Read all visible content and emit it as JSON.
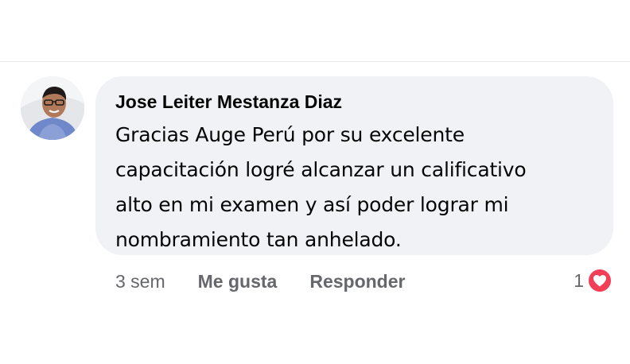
{
  "comment": {
    "author": "Jose Leiter Mestanza Diaz",
    "text_lines": [
      "Gracias Auge Perú por su excelente",
      "capacitación logré alcanzar un calificativo",
      "alto en mi examen y así poder lograr mi",
      "nombramiento tan anhelado."
    ],
    "timestamp": "3 sem",
    "like_label": "Me gusta",
    "reply_label": "Responder",
    "reaction_count": "1",
    "reaction_icon": "love-heart-icon"
  },
  "colors": {
    "bubble_background": "#f0f2f5",
    "text_primary": "#050505",
    "text_secondary": "#65676b",
    "heart_red": "#f33e58"
  }
}
